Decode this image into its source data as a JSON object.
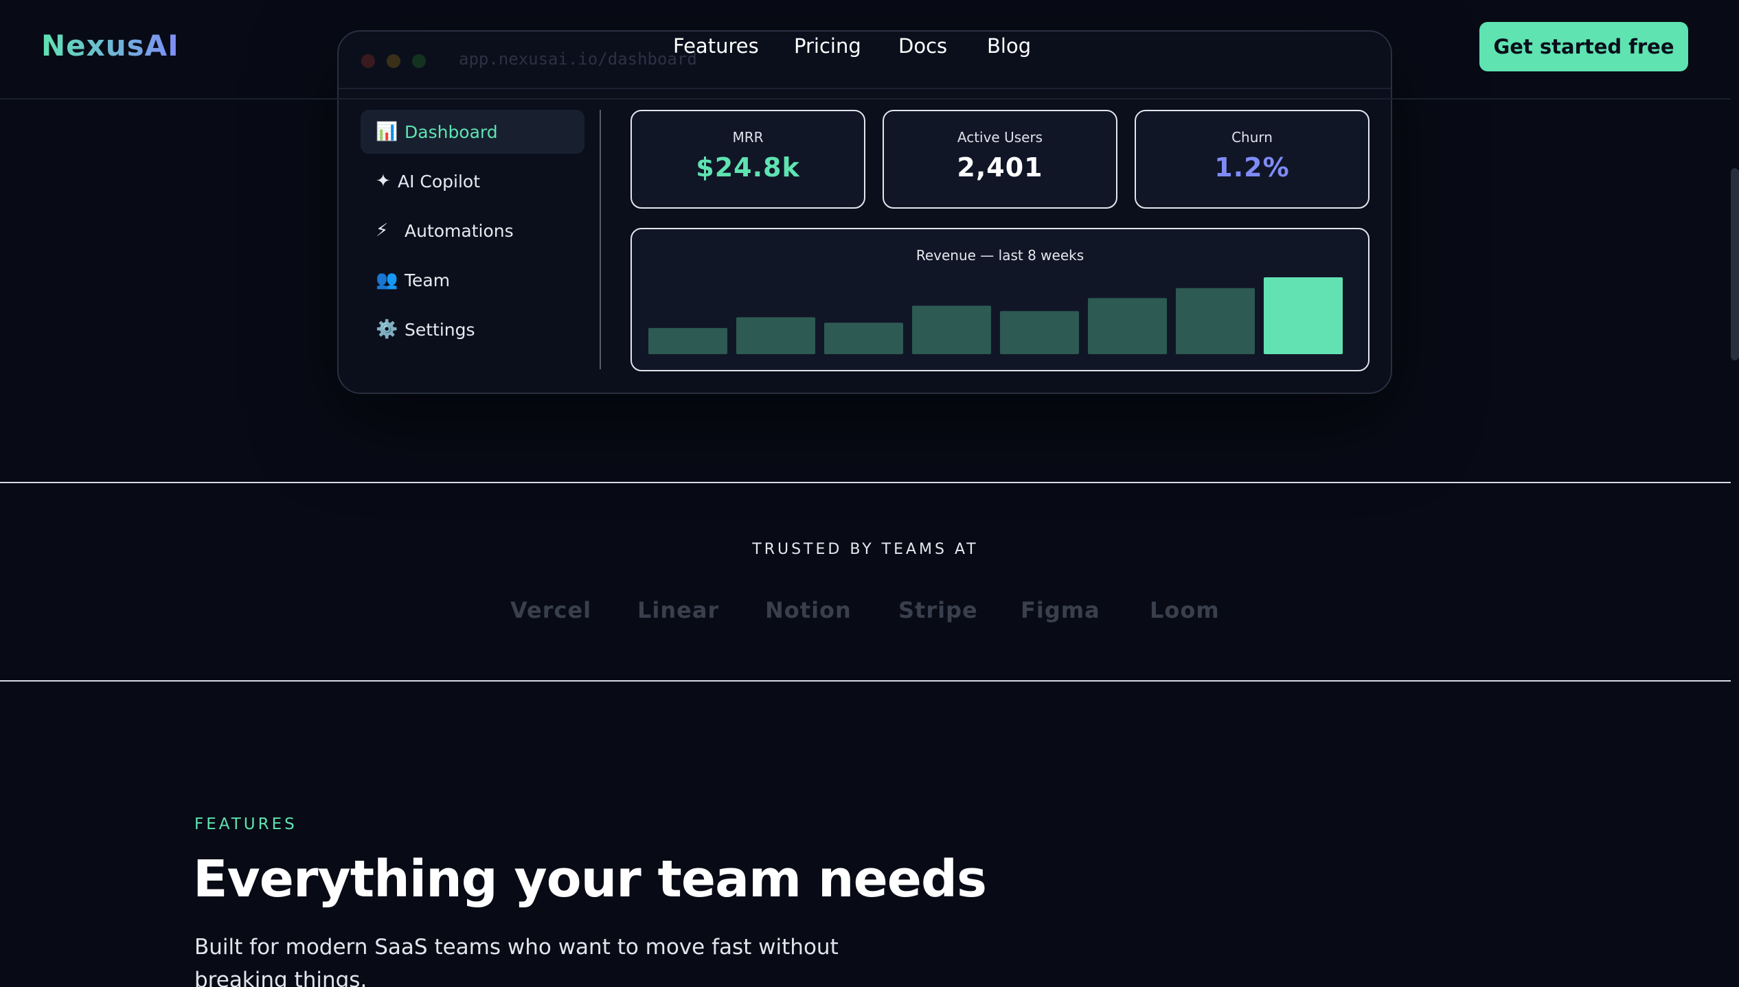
{
  "header": {
    "logo": "NexusAI",
    "nav": [
      "Features",
      "Pricing",
      "Docs",
      "Blog"
    ],
    "cta_label": "Get started free"
  },
  "mockup": {
    "url": "app.nexusai.io/dashboard",
    "sidebar": [
      {
        "icon": "📊",
        "icon_name": "bar-chart-icon",
        "label": "Dashboard",
        "active": true
      },
      {
        "icon": "✦",
        "icon_name": "sparkle-icon",
        "label": "AI Copilot",
        "active": false
      },
      {
        "icon": "⚡",
        "icon_name": "lightning-icon",
        "label": "Automations",
        "active": false
      },
      {
        "icon": "👥",
        "icon_name": "team-icon",
        "label": "Team",
        "active": false
      },
      {
        "icon": "⚙️",
        "icon_name": "gear-icon",
        "label": "Settings",
        "active": false
      }
    ],
    "stats": [
      {
        "label": "MRR",
        "value": "$24.8k",
        "color": "#5fe3b1"
      },
      {
        "label": "Active Users",
        "value": "2,401",
        "color": "#ffffff"
      },
      {
        "label": "Churn",
        "value": "1.2%",
        "color": "#7f8cf7"
      }
    ],
    "chart_title": "Revenue — last 8 weeks"
  },
  "chart_data": {
    "type": "bar",
    "title": "Revenue — last 8 weeks",
    "categories": [
      "",
      "",
      "",
      "",
      "",
      "",
      "",
      ""
    ],
    "values": [
      34,
      48,
      41,
      63,
      56,
      73,
      86,
      100
    ],
    "ylim": [
      0,
      100
    ],
    "highlight_last": true,
    "bar_color": "#2d5a52",
    "highlight_color": "#62e2b3",
    "grid": false
  },
  "trusted": {
    "label": "TRUSTED BY TEAMS AT",
    "logos": [
      "Vercel",
      "Linear",
      "Notion",
      "Stripe",
      "Figma",
      "Loom"
    ]
  },
  "features": {
    "eyebrow": "FEATURES",
    "title": "Everything your team needs",
    "subtitle": "Built for modern SaaS teams who want to move fast without breaking things."
  },
  "colors": {
    "background": "#080b16",
    "accent": "#5fe3b1",
    "accent_secondary": "#7f8cf7"
  }
}
